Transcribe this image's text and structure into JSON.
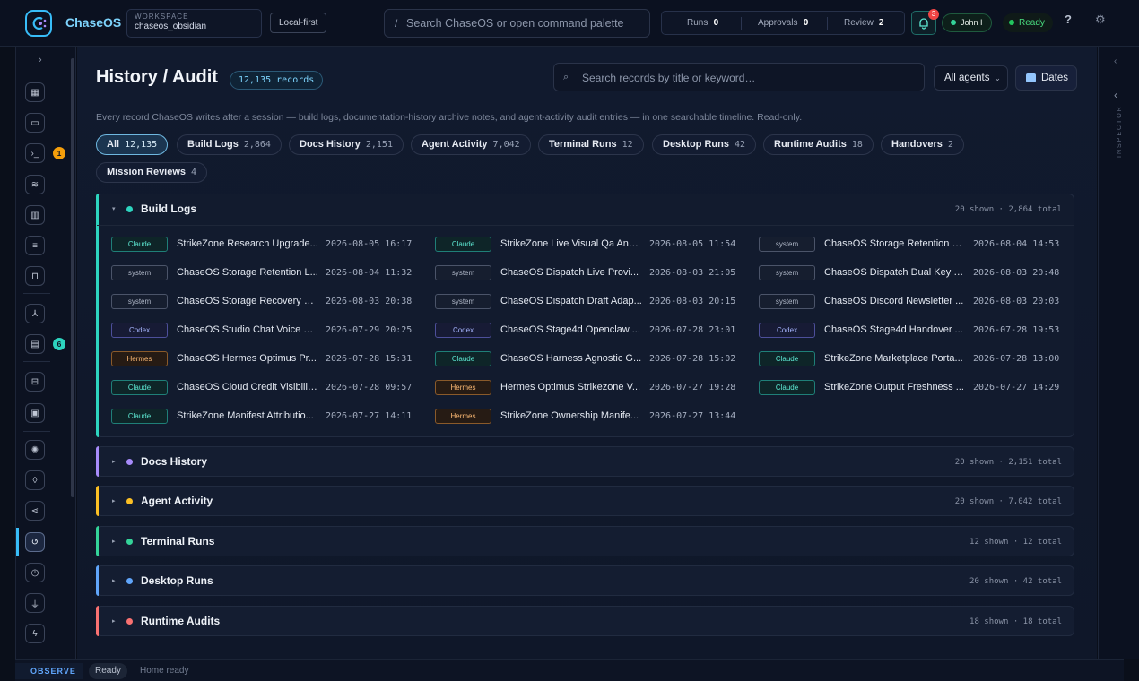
{
  "topbar": {
    "brand": "ChaseOS",
    "workspace_label": "WORKSPACE",
    "workspace_value": "chaseos_obsidian",
    "local_first": "Local-first",
    "search_slash": "/",
    "search_placeholder": "Search ChaseOS or open command palette",
    "runs_label": "Runs",
    "runs_value": "0",
    "approvals_label": "Approvals",
    "approvals_value": "0",
    "review_label": "Review",
    "review_value": "2",
    "notifications_count": "3",
    "user": "John I",
    "status": "Ready",
    "help": "?"
  },
  "rail": {
    "expand": "›",
    "badges": {
      "terminal": "1",
      "docs": "6"
    }
  },
  "main": {
    "title": "History / Audit",
    "record_count": "12,135 records",
    "search_placeholder": "Search records by title or keyword…",
    "agent_filter": "All agents",
    "dates_label": "Dates",
    "description": "Every record ChaseOS writes after a session — build logs, documentation-history archive notes, and agent-activity audit entries — in one searchable timeline. Read-only.",
    "chips": [
      {
        "label": "All",
        "count": "12,135",
        "active": true
      },
      {
        "label": "Build Logs",
        "count": "2,864"
      },
      {
        "label": "Docs History",
        "count": "2,151"
      },
      {
        "label": "Agent Activity",
        "count": "7,042"
      },
      {
        "label": "Terminal Runs",
        "count": "12"
      },
      {
        "label": "Desktop Runs",
        "count": "42"
      },
      {
        "label": "Runtime Audits",
        "count": "18"
      },
      {
        "label": "Handovers",
        "count": "2"
      },
      {
        "label": "Mission Reviews",
        "count": "4"
      }
    ],
    "groups": [
      {
        "name": "Build Logs",
        "stat": "20 shown · 2,864 total",
        "color": "#2dd4bf",
        "open": true
      },
      {
        "name": "Docs History",
        "stat": "20 shown · 2,151 total",
        "color": "#a78bfa"
      },
      {
        "name": "Agent Activity",
        "stat": "20 shown · 7,042 total",
        "color": "#fbbf24"
      },
      {
        "name": "Terminal Runs",
        "stat": "12 shown · 12 total",
        "color": "#34d399"
      },
      {
        "name": "Desktop Runs",
        "stat": "20 shown · 42 total",
        "color": "#60a5fa"
      },
      {
        "name": "Runtime Audits",
        "stat": "18 shown · 18 total",
        "color": "#f87171"
      }
    ],
    "build_logs": [
      {
        "agent": "Claude",
        "kind": "claude",
        "title": "StrikeZone Research Upgrade...",
        "time": "2026-08-05 16:17"
      },
      {
        "agent": "Claude",
        "kind": "claude",
        "title": "StrikeZone Live Visual Qa And...",
        "time": "2026-08-05 11:54"
      },
      {
        "agent": "system",
        "kind": "system",
        "title": "ChaseOS Storage Retention G...",
        "time": "2026-08-04 14:53"
      },
      {
        "agent": "system",
        "kind": "system",
        "title": "ChaseOS Storage Retention L...",
        "time": "2026-08-04 11:32"
      },
      {
        "agent": "system",
        "kind": "system",
        "title": "ChaseOS Dispatch Live Provi...",
        "time": "2026-08-03 21:05"
      },
      {
        "agent": "system",
        "kind": "system",
        "title": "ChaseOS Dispatch Dual Key G...",
        "time": "2026-08-03 20:48"
      },
      {
        "agent": "system",
        "kind": "system",
        "title": "ChaseOS Storage Recovery C...",
        "time": "2026-08-03 20:38"
      },
      {
        "agent": "system",
        "kind": "system",
        "title": "ChaseOS Dispatch Draft Adap...",
        "time": "2026-08-03 20:15"
      },
      {
        "agent": "system",
        "kind": "system",
        "title": "ChaseOS Discord Newsletter ...",
        "time": "2026-08-03 20:03"
      },
      {
        "agent": "Codex",
        "kind": "codex",
        "title": "ChaseOS Studio Chat Voice Li...",
        "time": "2026-07-29 20:25"
      },
      {
        "agent": "Codex",
        "kind": "codex",
        "title": "ChaseOS Stage4d Openclaw ...",
        "time": "2026-07-28 23:01"
      },
      {
        "agent": "Codex",
        "kind": "codex",
        "title": "ChaseOS Stage4d Handover ...",
        "time": "2026-07-28 19:53"
      },
      {
        "agent": "Hermes",
        "kind": "hermes",
        "title": "ChaseOS Hermes Optimus Pr...",
        "time": "2026-07-28 15:31"
      },
      {
        "agent": "Claude",
        "kind": "claude",
        "title": "ChaseOS Harness Agnostic G...",
        "time": "2026-07-28 15:02"
      },
      {
        "agent": "Claude",
        "kind": "claude",
        "title": "StrikeZone Marketplace Porta...",
        "time": "2026-07-28 13:00"
      },
      {
        "agent": "Claude",
        "kind": "claude",
        "title": "ChaseOS Cloud Credit Visibilit...",
        "time": "2026-07-28 09:57"
      },
      {
        "agent": "Hermes",
        "kind": "hermes",
        "title": "Hermes Optimus Strikezone V...",
        "time": "2026-07-27 19:28"
      },
      {
        "agent": "Claude",
        "kind": "claude",
        "title": "StrikeZone Output Freshness ...",
        "time": "2026-07-27 14:29"
      },
      {
        "agent": "Claude",
        "kind": "claude",
        "title": "StrikeZone Manifest Attributio...",
        "time": "2026-07-27 14:11"
      },
      {
        "agent": "Hermes",
        "kind": "hermes",
        "title": "StrikeZone Ownership Manife...",
        "time": "2026-07-27 13:44"
      }
    ]
  },
  "inspector": {
    "label": "INSPECTOR"
  },
  "statusbar": {
    "mode": "OBSERVE",
    "state": "Ready",
    "message": "Home ready"
  }
}
